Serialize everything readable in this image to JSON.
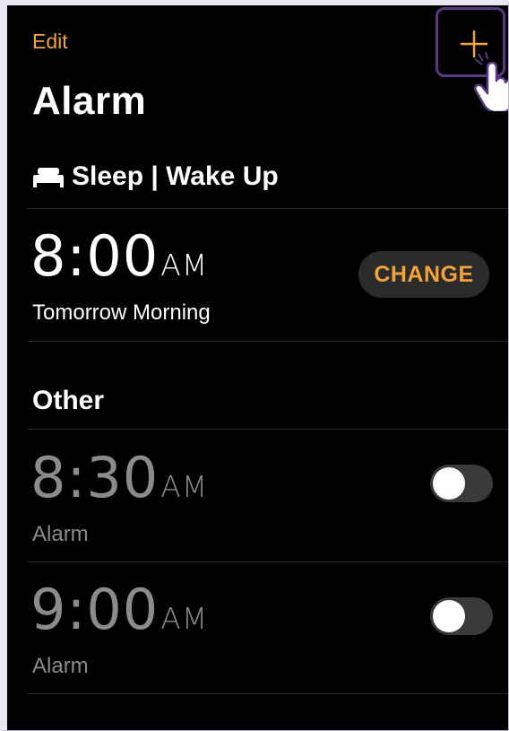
{
  "header": {
    "edit_label": "Edit",
    "add_icon": "plus-icon",
    "title": "Alarm"
  },
  "sleep": {
    "section_title": "Sleep | Wake Up",
    "icon": "bed-icon",
    "time": "8:00",
    "ampm": "AM",
    "subtitle": "Tomorrow Morning",
    "change_label": "CHANGE"
  },
  "other": {
    "section_title": "Other",
    "alarms": [
      {
        "time": "8:30",
        "ampm": "AM",
        "label": "Alarm",
        "enabled": false
      },
      {
        "time": "9:00",
        "ampm": "AM",
        "label": "Alarm",
        "enabled": false
      }
    ]
  },
  "colors": {
    "accent": "#f2a33a",
    "background": "#000000",
    "inactive_text": "#8b8b8b",
    "cursor_highlight": "#5a3a86"
  }
}
